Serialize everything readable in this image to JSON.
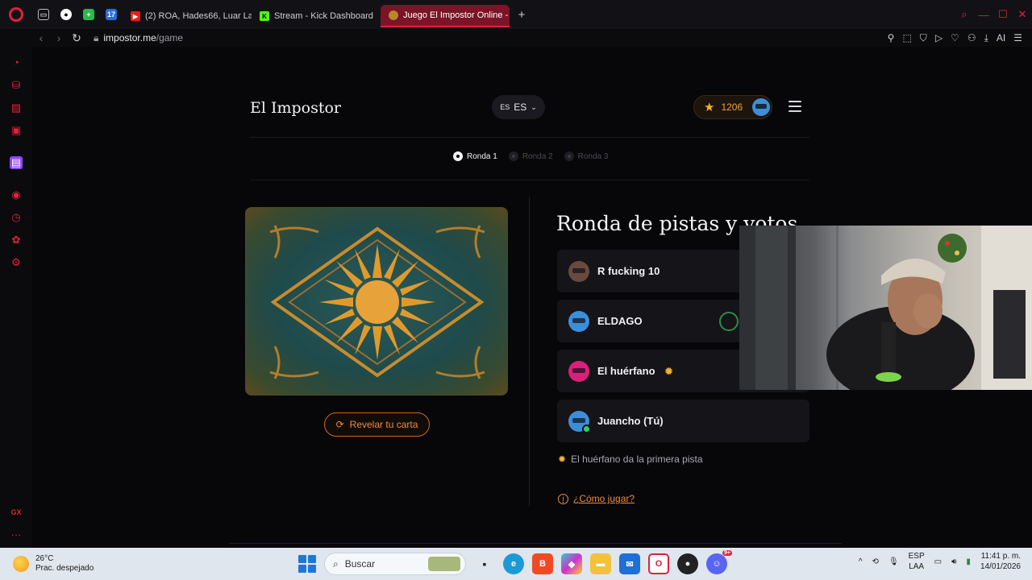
{
  "browser": {
    "tabs": [
      {
        "label": "(2) ROA, Hades66, Luar La",
        "favicon_color": "#e62117"
      },
      {
        "label": "Stream - Kick Dashboard",
        "favicon_color": "#53fc18"
      },
      {
        "label": "Juego El Impostor Online -",
        "favicon_color": "#b8862b",
        "active": true
      }
    ],
    "pinned": [
      "gamepad-icon",
      "record-icon",
      "plus-app-icon",
      "17-app-icon"
    ],
    "pinned_label_17": "17",
    "url_host": "impostor.me",
    "url_path": "/game",
    "ai_label": "AI",
    "new_tab": "+"
  },
  "site": {
    "brand": "El Impostor",
    "lang_flag": "ES",
    "lang_label": "ES",
    "score": "1206"
  },
  "rounds": [
    {
      "label": "Ronda 1",
      "active": true
    },
    {
      "label": "Ronda 2",
      "active": false
    },
    {
      "label": "Ronda 3",
      "active": false
    }
  ],
  "card": {
    "reveal_label": "Revelar tu carta",
    "colors": {
      "teal": "#1f4a4b",
      "gold": "#d9922a"
    }
  },
  "game": {
    "section_title": "Ronda de pistas y votos",
    "players": [
      {
        "name": "R fucking 10",
        "avatar_color": "#6a4a3e"
      },
      {
        "name": "ELDAGO",
        "avatar_color": "#3b8fd9"
      },
      {
        "name": "El huérfano",
        "avatar_color": "#d9207a"
      },
      {
        "name": "Juancho (Tú)",
        "avatar_color": "#3b8fd9"
      }
    ],
    "hint": "El huérfano da la primera pista",
    "howto": "¿Cómo jugar?"
  },
  "taskbar": {
    "temp": "26°C",
    "weather": "Prac. despejado",
    "search": "Buscar",
    "lang_1": "ESP",
    "lang_2": "LAA",
    "time": "11:41 p. m.",
    "date": "14/01/2026",
    "discord_badge": "9+"
  },
  "sidebar": {
    "gx_label": "GX",
    "more_label": "···"
  }
}
